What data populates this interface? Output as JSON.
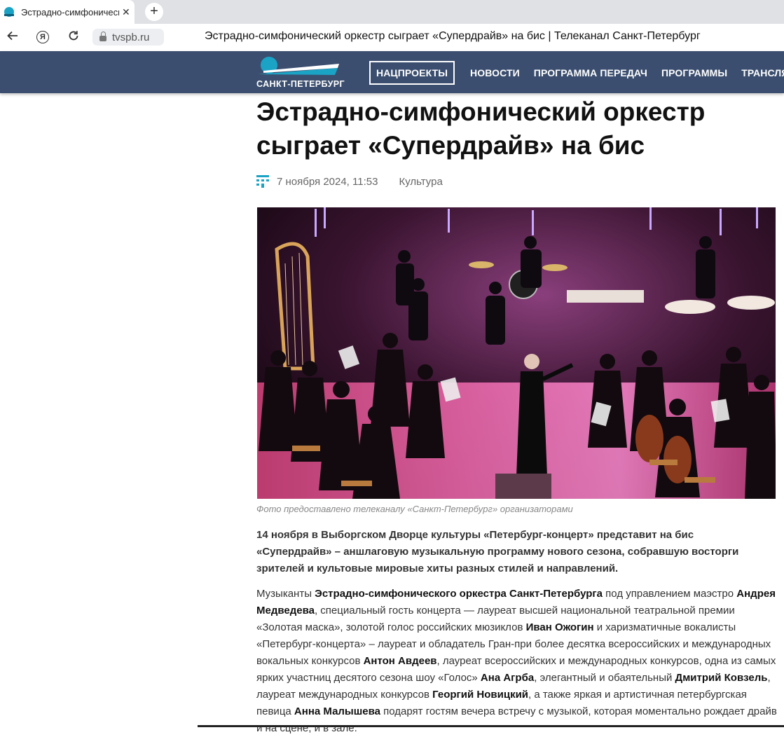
{
  "browser": {
    "tab_title": "Эстрадно-симфонический оркестр сыграет «Супердрайв» на бис",
    "tab_close": "✕",
    "new_tab": "+",
    "url": "tvspb.ru",
    "page_title": "Эстрадно-симфонический оркестр сыграет «Супердрайв» на бис | Телеканал Санкт-Петербург"
  },
  "site": {
    "logo_text": "САНКТ-ПЕТЕРБУРГ",
    "nav": [
      "НАЦПРОЕКТЫ",
      "НОВОСТИ",
      "ПРОГРАММА ПЕРЕДАЧ",
      "ПРОГРАММЫ",
      "ТРАНСЛЯЦИИ"
    ],
    "header_color": "#3b4e6f",
    "accent_color": "#1ba3c6"
  },
  "article": {
    "title": "Эстрадно-симфонический оркестр сыграет «Супердрайв» на бис",
    "date": "7 ноября 2024, 11:53",
    "category": "Культура",
    "photo_caption": "Фото предоставлено телеканалу «Санкт-Петербург» организаторами",
    "lead": "14 ноября в Выборгском Дворце культуры «Петербург-концерт» представит на бис «Супердрайв» – аншлаговую музыкальную программу нового сезона, собравшую восторги зрителей и культовые мировые хиты разных стилей и направлений.",
    "body": [
      "Музыканты ",
      "Эстрадно-симфонического оркестра Санкт-Петербурга",
      " под управлением маэстро ",
      "Андрея Медведева",
      ", специальный гость концерта — лауреат высшей национальной театральной премии «Золотая маска», золотой голос российских мюзиклов ",
      "Иван Ожогин",
      " и харизматичные вокалисты «Петербург-концерта» – лауреат и обладатель Гран-при более десятка всероссийских и международных вокальных конкурсов ",
      "Антон Авдеев",
      ", лауреат всероссийских и международных конкурсов, одна из самых ярких участниц десятого сезона шоу «Голос» ",
      "Ана Агрба",
      ", элегантный и обаятельный ",
      "Дмитрий Ковзель",
      ", лауреат международных конкурсов ",
      "Георгий Новицкий",
      ", а также яркая и артистичная петербургская певица ",
      "Анна Малышева",
      " подарят гостям вечера встречу с музыкой, которая моментально рождает драйв и на сцене, и в зале."
    ]
  }
}
